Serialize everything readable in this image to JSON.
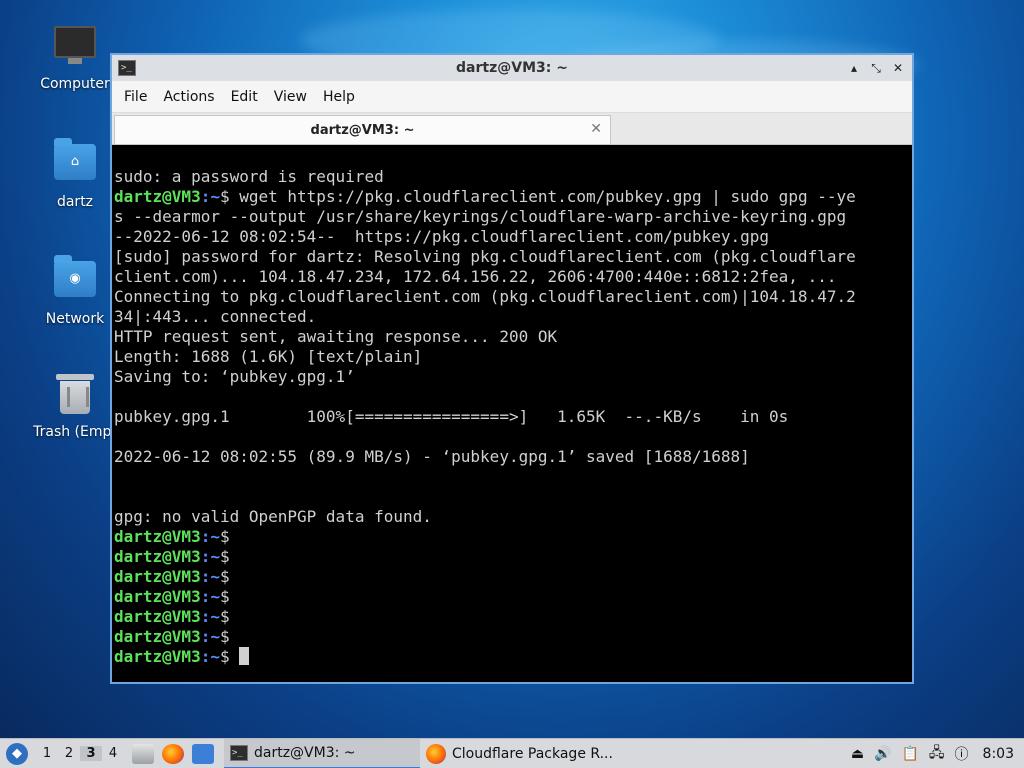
{
  "desktop": {
    "icons": [
      {
        "label": "Computer"
      },
      {
        "label": "dartz"
      },
      {
        "label": "Network"
      },
      {
        "label": "Trash (Empt"
      }
    ]
  },
  "window": {
    "title": "dartz@VM3: ~",
    "menu": [
      "File",
      "Actions",
      "Edit",
      "View",
      "Help"
    ],
    "tab_label": "dartz@VM3: ~",
    "controls": {
      "minimize": "▴",
      "maximize": "⤡",
      "close": "✕"
    }
  },
  "terminal": {
    "prompt_user": "dartz@VM3",
    "prompt_path": ":~",
    "prompt_symbol": "$",
    "lines": [
      {
        "type": "text",
        "text": "sudo: a password is required"
      },
      {
        "type": "prompt",
        "text": " wget https://pkg.cloudflareclient.com/pubkey.gpg | sudo gpg --ye"
      },
      {
        "type": "text",
        "text": "s --dearmor --output /usr/share/keyrings/cloudflare-warp-archive-keyring.gpg"
      },
      {
        "type": "text",
        "text": "--2022-06-12 08:02:54--  https://pkg.cloudflareclient.com/pubkey.gpg"
      },
      {
        "type": "text",
        "text": "[sudo] password for dartz: Resolving pkg.cloudflareclient.com (pkg.cloudflare"
      },
      {
        "type": "text",
        "text": "client.com)... 104.18.47.234, 172.64.156.22, 2606:4700:440e::6812:2fea, ..."
      },
      {
        "type": "text",
        "text": "Connecting to pkg.cloudflareclient.com (pkg.cloudflareclient.com)|104.18.47.2"
      },
      {
        "type": "text",
        "text": "34|:443... connected."
      },
      {
        "type": "text",
        "text": "HTTP request sent, awaiting response... 200 OK"
      },
      {
        "type": "text",
        "text": "Length: 1688 (1.6K) [text/plain]"
      },
      {
        "type": "text",
        "text": "Saving to: ‘pubkey.gpg.1’"
      },
      {
        "type": "text",
        "text": ""
      },
      {
        "type": "text",
        "text": "pubkey.gpg.1        100%[================>]   1.65K  --.-KB/s    in 0s"
      },
      {
        "type": "text",
        "text": ""
      },
      {
        "type": "text",
        "text": "2022-06-12 08:02:55 (89.9 MB/s) - ‘pubkey.gpg.1’ saved [1688/1688]"
      },
      {
        "type": "text",
        "text": ""
      },
      {
        "type": "text",
        "text": ""
      },
      {
        "type": "text",
        "text": "gpg: no valid OpenPGP data found."
      },
      {
        "type": "prompt",
        "text": ""
      },
      {
        "type": "prompt",
        "text": ""
      },
      {
        "type": "prompt",
        "text": ""
      },
      {
        "type": "prompt",
        "text": ""
      },
      {
        "type": "prompt",
        "text": ""
      },
      {
        "type": "prompt",
        "text": ""
      },
      {
        "type": "prompt-cursor",
        "text": " "
      }
    ]
  },
  "taskbar": {
    "workspaces": [
      "1",
      "2",
      "3",
      "4"
    ],
    "active_workspace": "3",
    "tasks": [
      {
        "label": "dartz@VM3: ~",
        "icon": "terminal-icon"
      },
      {
        "label": "Cloudflare Package R...",
        "icon": "firefox-icon"
      }
    ],
    "clock": "8:03"
  }
}
